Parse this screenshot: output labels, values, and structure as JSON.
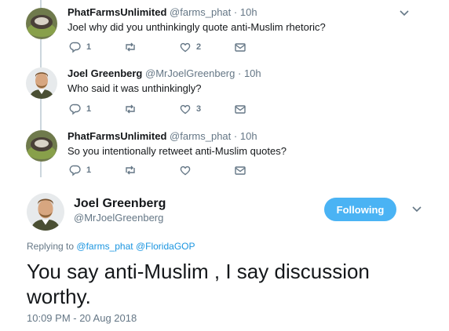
{
  "thread": [
    {
      "name": "PhatFarmsUnlimited",
      "handle": "@farms_phat",
      "dot": "·",
      "time": "10h",
      "text": "Joel why did you unthinkingly quote anti-Muslim rhetoric?",
      "reply_count": "1",
      "retweet_count": "",
      "like_count": "2"
    },
    {
      "name": "Joel Greenberg",
      "handle": "@MrJoelGreenberg",
      "dot": "·",
      "time": "10h",
      "text": "Who said it was unthinkingly?",
      "reply_count": "1",
      "retweet_count": "",
      "like_count": "3"
    },
    {
      "name": "PhatFarmsUnlimited",
      "handle": "@farms_phat",
      "dot": "·",
      "time": "10h",
      "text": "So you intentionally retweet anti-Muslim quotes?",
      "reply_count": "1",
      "retweet_count": "",
      "like_count": ""
    }
  ],
  "main_tweet": {
    "name": "Joel Greenberg",
    "handle": "@MrJoelGreenberg",
    "follow_label": "Following",
    "replying_prefix": "Replying to",
    "mention_1": "@farms_phat",
    "mention_2": "@FloridaGOP",
    "text": "You say anti-Muslim , I say discussion worthy.",
    "timestamp": "10:09 PM - 20 Aug 2018"
  },
  "colors": {
    "accent": "#1b95e0",
    "follow_bg": "#4ab3f4",
    "muted": "#657786",
    "line": "#ccd6dd"
  },
  "icons": [
    "reply-icon",
    "retweet-icon",
    "like-icon",
    "dm-icon",
    "chevron-down-icon"
  ]
}
